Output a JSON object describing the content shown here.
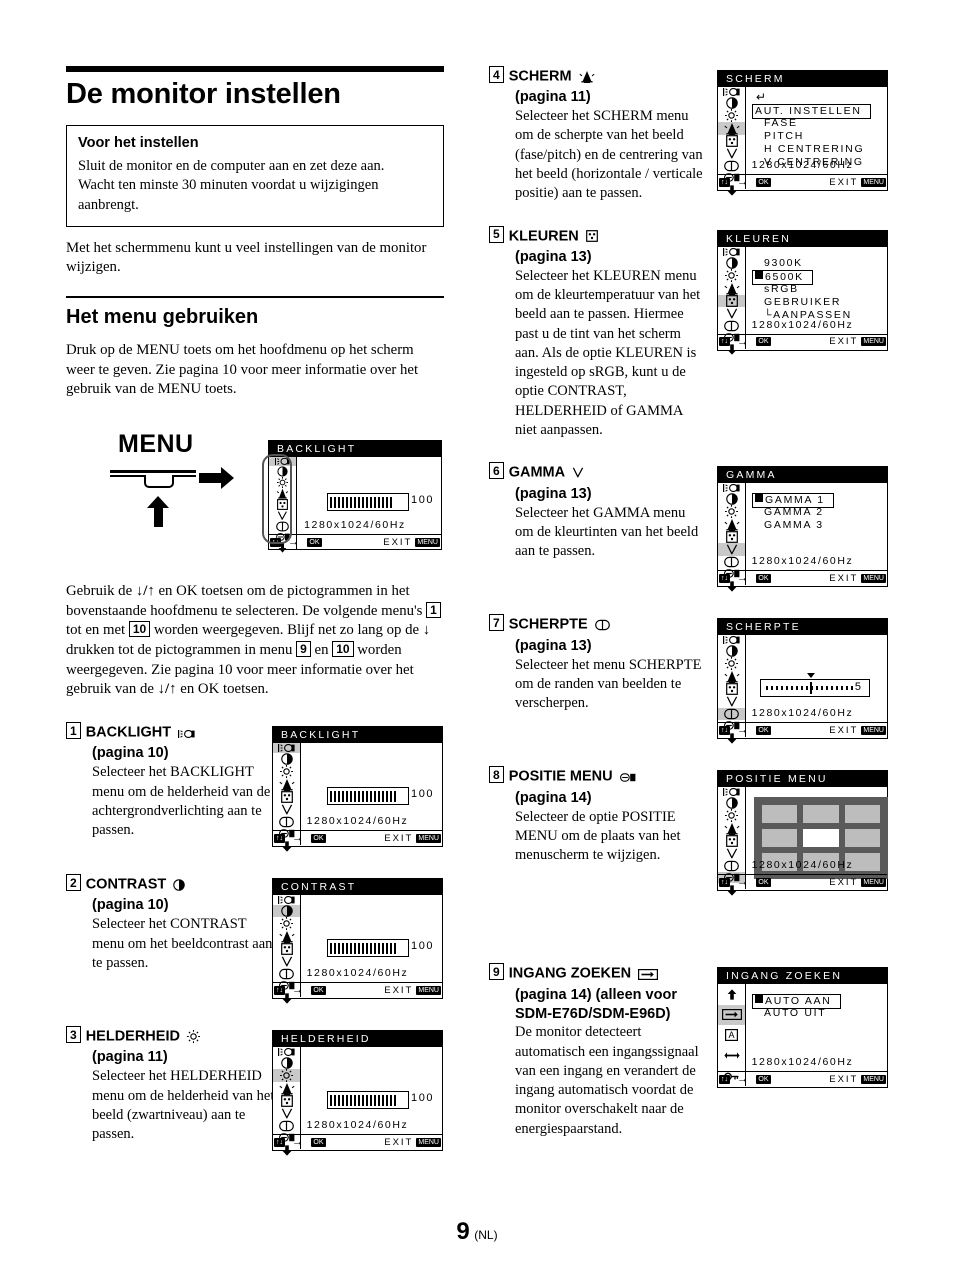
{
  "page": {
    "number": "9",
    "language": "(NL)"
  },
  "title": "De monitor instellen",
  "notice": {
    "heading": "Voor het instellen",
    "line1": "Sluit de monitor en de computer aan en zet deze aan.",
    "line2": "Wacht ten minste 30 minuten voordat u wijzigingen aanbrengt."
  },
  "intro": "Met het schermmenu kunt u veel instellingen van de monitor wijzigen.",
  "section2": {
    "heading": "Het menu gebruiken",
    "paragraph": "Druk op de MENU toets om het hoofdmenu op het scherm weer te geven. Zie pagina 10 voor meer informatie over het gebruik van de MENU toets."
  },
  "menu_diagram": {
    "label": "MENU",
    "osd": {
      "title": "BACKLIGHT",
      "value": "100",
      "resolution": "1280x1024/60Hz",
      "footer": {
        "updown": "↑↓",
        "arrow": "→",
        "ok": "OK",
        "exit": "EXIT",
        "menu_key": "MENU"
      }
    }
  },
  "usage_paragraph": {
    "part1": "Gebruik de ",
    "updown1": "↓/↑",
    "part2": " en OK toetsen om de pictogrammen in het bovenstaande hoofdmenu te selecteren. De volgende menu's ",
    "n1": "1",
    "part3": " tot en met ",
    "n10a": "10",
    "part4": " worden weergegeven. Blijf net zo lang op de ",
    "down": "↓",
    "part5": " drukken tot de pictogrammen in menu ",
    "n9": "9",
    "part6": " en ",
    "n10b": "10",
    "part7": " worden weergegeven. Zie pagina 10 voor meer informatie over het gebruik van de ",
    "updown2": "↓/↑",
    "part8": " en OK toetsen."
  },
  "items": [
    {
      "num": "1",
      "title": "BACKLIGHT",
      "icon": "backlight-icon",
      "page_ref": "(pagina 10)",
      "text": "Selecteer het BACKLIGHT menu om de helderheid van de achtergrondverlichting aan te passen.",
      "osd": {
        "title": "BACKLIGHT",
        "kind": "slider",
        "value": "100",
        "selected_index": 0,
        "resolution": "1280x1024/60Hz"
      }
    },
    {
      "num": "2",
      "title": "CONTRAST",
      "icon": "contrast-icon",
      "page_ref": "(pagina 10)",
      "text": "Selecteer het CONTRAST menu om het beeldcontrast aan te passen.",
      "osd": {
        "title": "CONTRAST",
        "kind": "slider",
        "value": "100",
        "selected_index": 1,
        "resolution": "1280x1024/60Hz"
      }
    },
    {
      "num": "3",
      "title": "HELDERHEID",
      "icon": "brightness-icon",
      "page_ref": "(pagina 11)",
      "text": "Selecteer het HELDERHEID menu om de helderheid van het beeld (zwartniveau) aan te passen.",
      "osd": {
        "title": "HELDERHEID",
        "kind": "slider",
        "value": "100",
        "selected_index": 2,
        "resolution": "1280x1024/60Hz"
      }
    },
    {
      "num": "4",
      "title": "SCHERM",
      "icon": "screen-icon",
      "page_ref": "(pagina 11)",
      "text": "Selecteer het SCHERM menu om de scherpte van het beeld (fase/pitch) en de centrering van het beeld (horizontale / verticale positie) aan te passen.",
      "osd": {
        "title": "SCHERM",
        "kind": "options",
        "return_arrow": true,
        "options": [
          "AUT. INSTELLEN",
          "FASE",
          "PITCH",
          "H CENTRERING",
          "V CENTRERING"
        ],
        "boxed_index": 0,
        "bullet_index": -1,
        "selected_index": 3,
        "resolution": "1280x1024/60Hz"
      }
    },
    {
      "num": "5",
      "title": "KLEUREN",
      "icon": "color-icon",
      "page_ref": "(pagina 13)",
      "text": "Selecteer het KLEUREN menu om de kleurtemperatuur van het beeld aan te passen. Hiermee past u de tint van het scherm aan. Als de optie KLEUREN is ingesteld op sRGB, kunt u de optie CONTRAST, HELDERHEID of GAMMA niet aanpassen.",
      "osd": {
        "title": "KLEUREN",
        "kind": "options",
        "options": [
          "9300K",
          "6500K",
          "sRGB",
          "GEBRUIKER",
          "└AANPASSEN"
        ],
        "boxed_index": 1,
        "bullet_index": 1,
        "selected_index": 4,
        "resolution": "1280x1024/60Hz"
      }
    },
    {
      "num": "6",
      "title": "GAMMA",
      "icon": "gamma-icon",
      "page_ref": "(pagina 13)",
      "text": "Selecteer het GAMMA menu om de kleurtinten van het beeld aan te passen.",
      "osd": {
        "title": "GAMMA",
        "kind": "options",
        "options": [
          "GAMMA 1",
          "GAMMA 2",
          "GAMMA 3"
        ],
        "boxed_index": 0,
        "bullet_index": 0,
        "selected_index": 5,
        "resolution": "1280x1024/60Hz"
      }
    },
    {
      "num": "7",
      "title": "SCHERPTE",
      "icon": "sharpness-icon",
      "page_ref": "(pagina 13)",
      "text": "Selecteer het menu SCHERPTE om de randen van beelden te verscherpen.",
      "osd": {
        "title": "SCHERPTE",
        "kind": "sharpness",
        "value": "5",
        "selected_index": 6,
        "resolution": "1280x1024/60Hz"
      }
    },
    {
      "num": "8",
      "title": "POSITIE MENU",
      "icon": "menu-position-icon",
      "page_ref": "(pagina 14)",
      "text": "Selecteer de optie POSITIE MENU om de plaats van het menuscherm te wijzigen.",
      "osd": {
        "title": "POSITIE MENU",
        "kind": "grid",
        "active_cell": 4,
        "selected_index": 7,
        "resolution": "1280x1024/60Hz"
      }
    },
    {
      "num": "9",
      "title": "INGANG ZOEKEN",
      "icon": "input-search-icon",
      "page_ref": "(pagina 14) (alleen voor SDM-E76D/SDM-E96D)",
      "text": "De monitor detecteert automatisch een ingangssignaal van een ingang en verandert de ingang automatisch voordat de monitor overschakelt naar de energiespaarstand.",
      "osd": {
        "title": "INGANG ZOEKEN",
        "kind": "options",
        "options": [
          "AUTO AAN",
          "AUTO UIT"
        ],
        "boxed_index": 0,
        "bullet_index": 0,
        "selected_index": 1,
        "sidebar": "secondary",
        "resolution": "1280x1024/60Hz"
      }
    }
  ],
  "osd_footer": {
    "updown": "↑↓",
    "arrow": "→",
    "ok": "OK",
    "exit": "EXIT",
    "menu_key": "MENU"
  }
}
